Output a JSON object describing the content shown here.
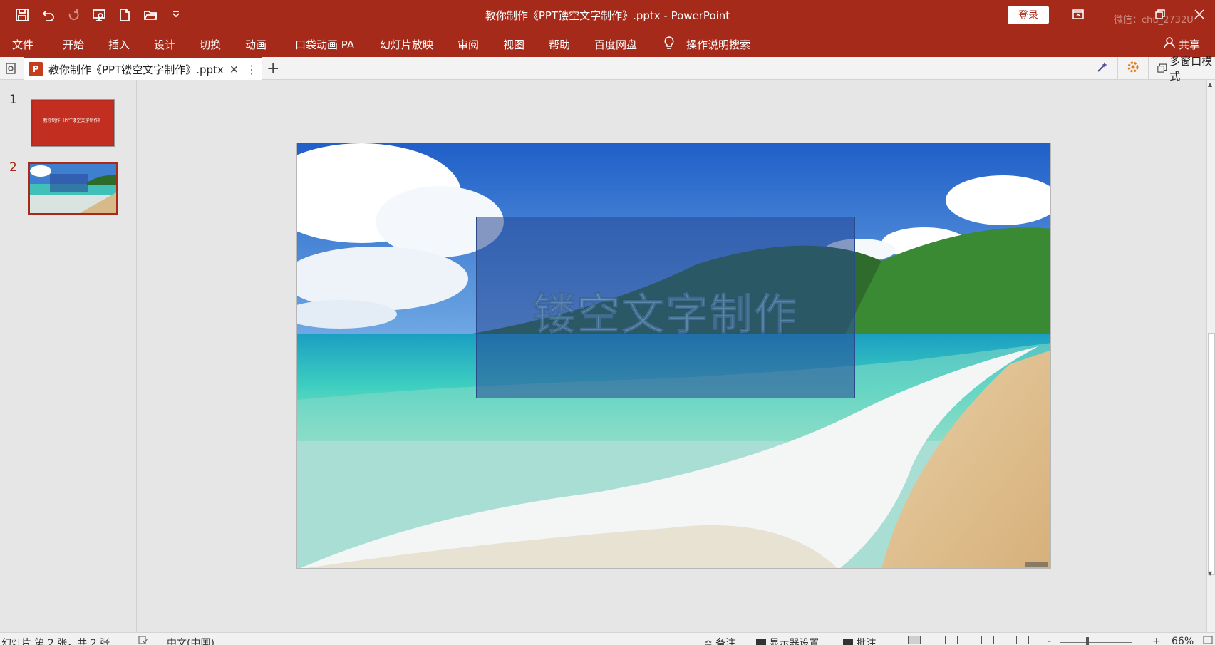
{
  "window": {
    "title": "教你制作《PPT镂空文字制作》.pptx  -  PowerPoint",
    "login_label": "登录",
    "watermark": "微信：chu_2732U"
  },
  "ribbon": {
    "tabs": [
      "文件",
      "开始",
      "插入",
      "设计",
      "切换",
      "动画",
      "口袋动画 PA",
      "幻灯片放映",
      "审阅",
      "视图",
      "帮助",
      "百度网盘"
    ],
    "search_label": "操作说明搜索",
    "share_label": "共享"
  },
  "doc_tab": {
    "filename": "教你制作《PPT镂空文字制作》.pptx",
    "icon_letter": "P",
    "multi_window_label": "多窗口模式"
  },
  "thumbnails": {
    "items": [
      {
        "number": "1",
        "caption": "教你制作《PPT镂空文字制作》"
      },
      {
        "number": "2"
      }
    ],
    "active_index": 2
  },
  "slide": {
    "hollow_text": "镂空文字制作",
    "colors": {
      "accent": "#a52a1a",
      "box": "#284896"
    }
  },
  "statusbar": {
    "slide_info": "幻灯片 第 2 张，共 2 张",
    "language": "中文(中国)",
    "notes_label": "备注",
    "display_settings_label": "显示器设置",
    "comments_label": "批注",
    "zoom_minus": "-",
    "zoom_plus": "+",
    "zoom_level": "66%"
  }
}
